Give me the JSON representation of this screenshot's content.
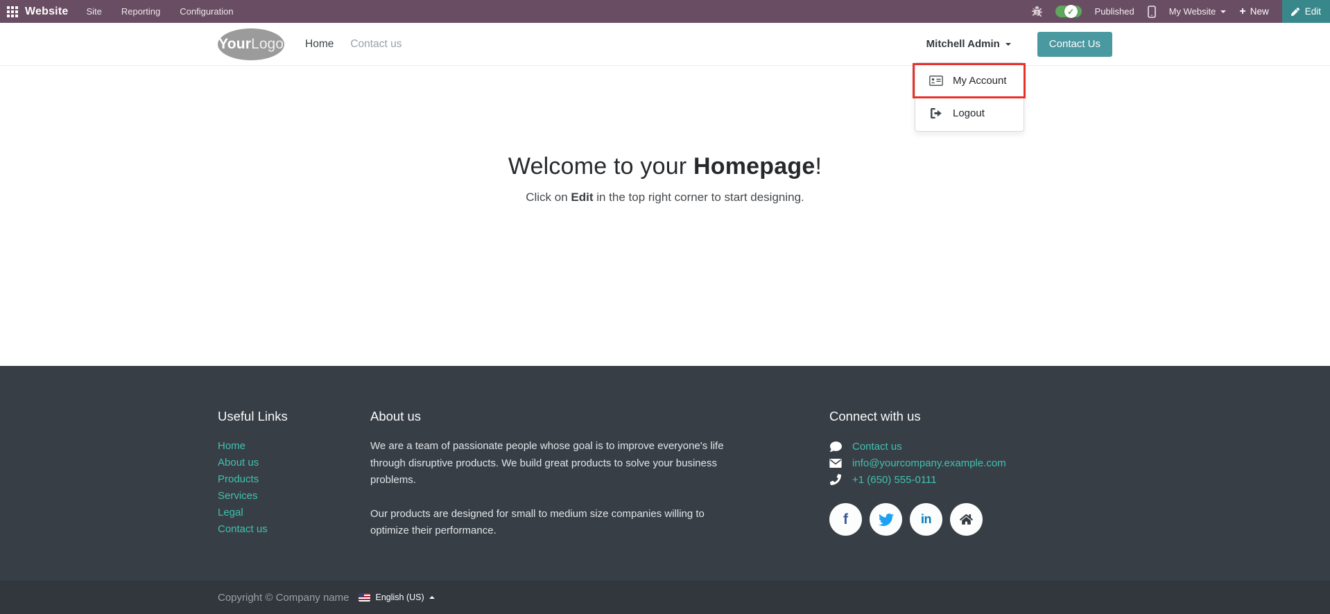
{
  "topbar": {
    "app_name": "Website",
    "menus": [
      "Site",
      "Reporting",
      "Configuration"
    ],
    "published_label": "Published",
    "website_selector_label": "My Website",
    "new_label": "New",
    "edit_label": "Edit",
    "toggle_check": "✓",
    "plus_glyph": "+"
  },
  "header": {
    "logo_your": "Your",
    "logo_logo": "Logo",
    "nav": {
      "home": "Home",
      "contact": "Contact us"
    },
    "user_name": "Mitchell Admin",
    "cta_label": "Contact Us"
  },
  "user_menu": {
    "my_account": "My Account",
    "logout": "Logout"
  },
  "hero": {
    "title_prefix": "Welcome to your ",
    "title_bold": "Homepage",
    "title_suffix": "!",
    "subtitle_prefix": "Click on ",
    "subtitle_bold": "Edit",
    "subtitle_suffix": " in the top right corner to start designing."
  },
  "footer": {
    "useful_links": {
      "title": "Useful Links",
      "links": [
        "Home",
        "About us",
        "Products",
        "Services",
        "Legal",
        "Contact us"
      ]
    },
    "about": {
      "title": "About us",
      "p1": "We are a team of passionate people whose goal is to improve everyone's life through disruptive products. We build great products to solve your business problems.",
      "p2": "Our products are designed for small to medium size companies willing to optimize their performance."
    },
    "connect": {
      "title": "Connect with us",
      "contact_link": "Contact us",
      "email": "info@yourcompany.example.com",
      "phone": "+1 (650) 555-0111",
      "facebook_glyph": "f",
      "linkedin_glyph": "in"
    },
    "copyright": "Copyright © Company name",
    "language": "English (US)"
  },
  "colors": {
    "topbar_bg": "#694d62",
    "edit_button_bg": "#38878b",
    "toggle_green": "#5fa75f",
    "cta_bg": "#4a98a0",
    "footer_bg": "#383e46",
    "copyright_bg": "#31373d",
    "footer_link_teal": "#3fc2b1",
    "annotation_red": "#e7312b",
    "facebook_blue": "#3b5998",
    "twitter_blue": "#1da1f2",
    "linkedin_blue": "#0077b5"
  }
}
